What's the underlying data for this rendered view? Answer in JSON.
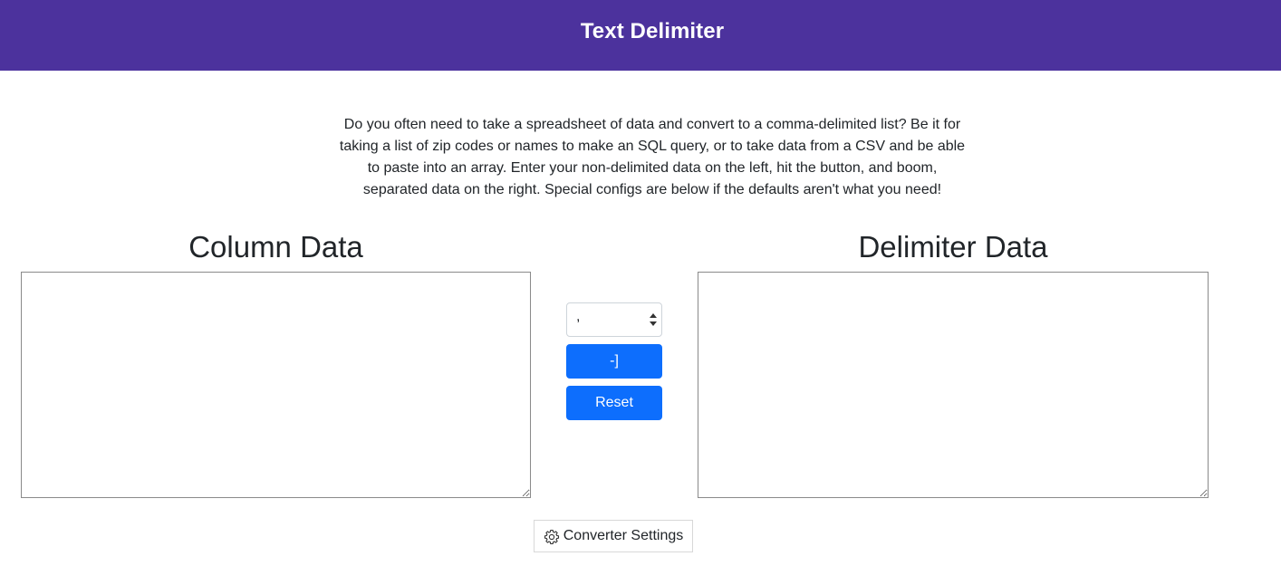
{
  "header": {
    "title": "Text Delimiter",
    "background_color": "#4c329d"
  },
  "intro": {
    "text": "Do you often need to take a spreadsheet of data and convert to a comma-delimited list? Be it for taking a list of zip codes or names to make an SQL query, or to take data from a CSV and be able to paste into an array. Enter your non-delimited data on the left, hit the button, and boom, separated data on the right. Special configs are below if the defaults aren't what you need!"
  },
  "column_panel": {
    "heading": "Column Data",
    "value": ""
  },
  "delimiter_panel": {
    "heading": "Delimiter Data",
    "value": ""
  },
  "controls": {
    "delimiter_select": {
      "selected": ",",
      "icon": "select-updown-arrows-icon"
    },
    "convert_label": "-]",
    "reset_label": "Reset",
    "button_color": "#0d6efd"
  },
  "settings": {
    "label": "Converter Settings",
    "icon": "gear-icon"
  }
}
